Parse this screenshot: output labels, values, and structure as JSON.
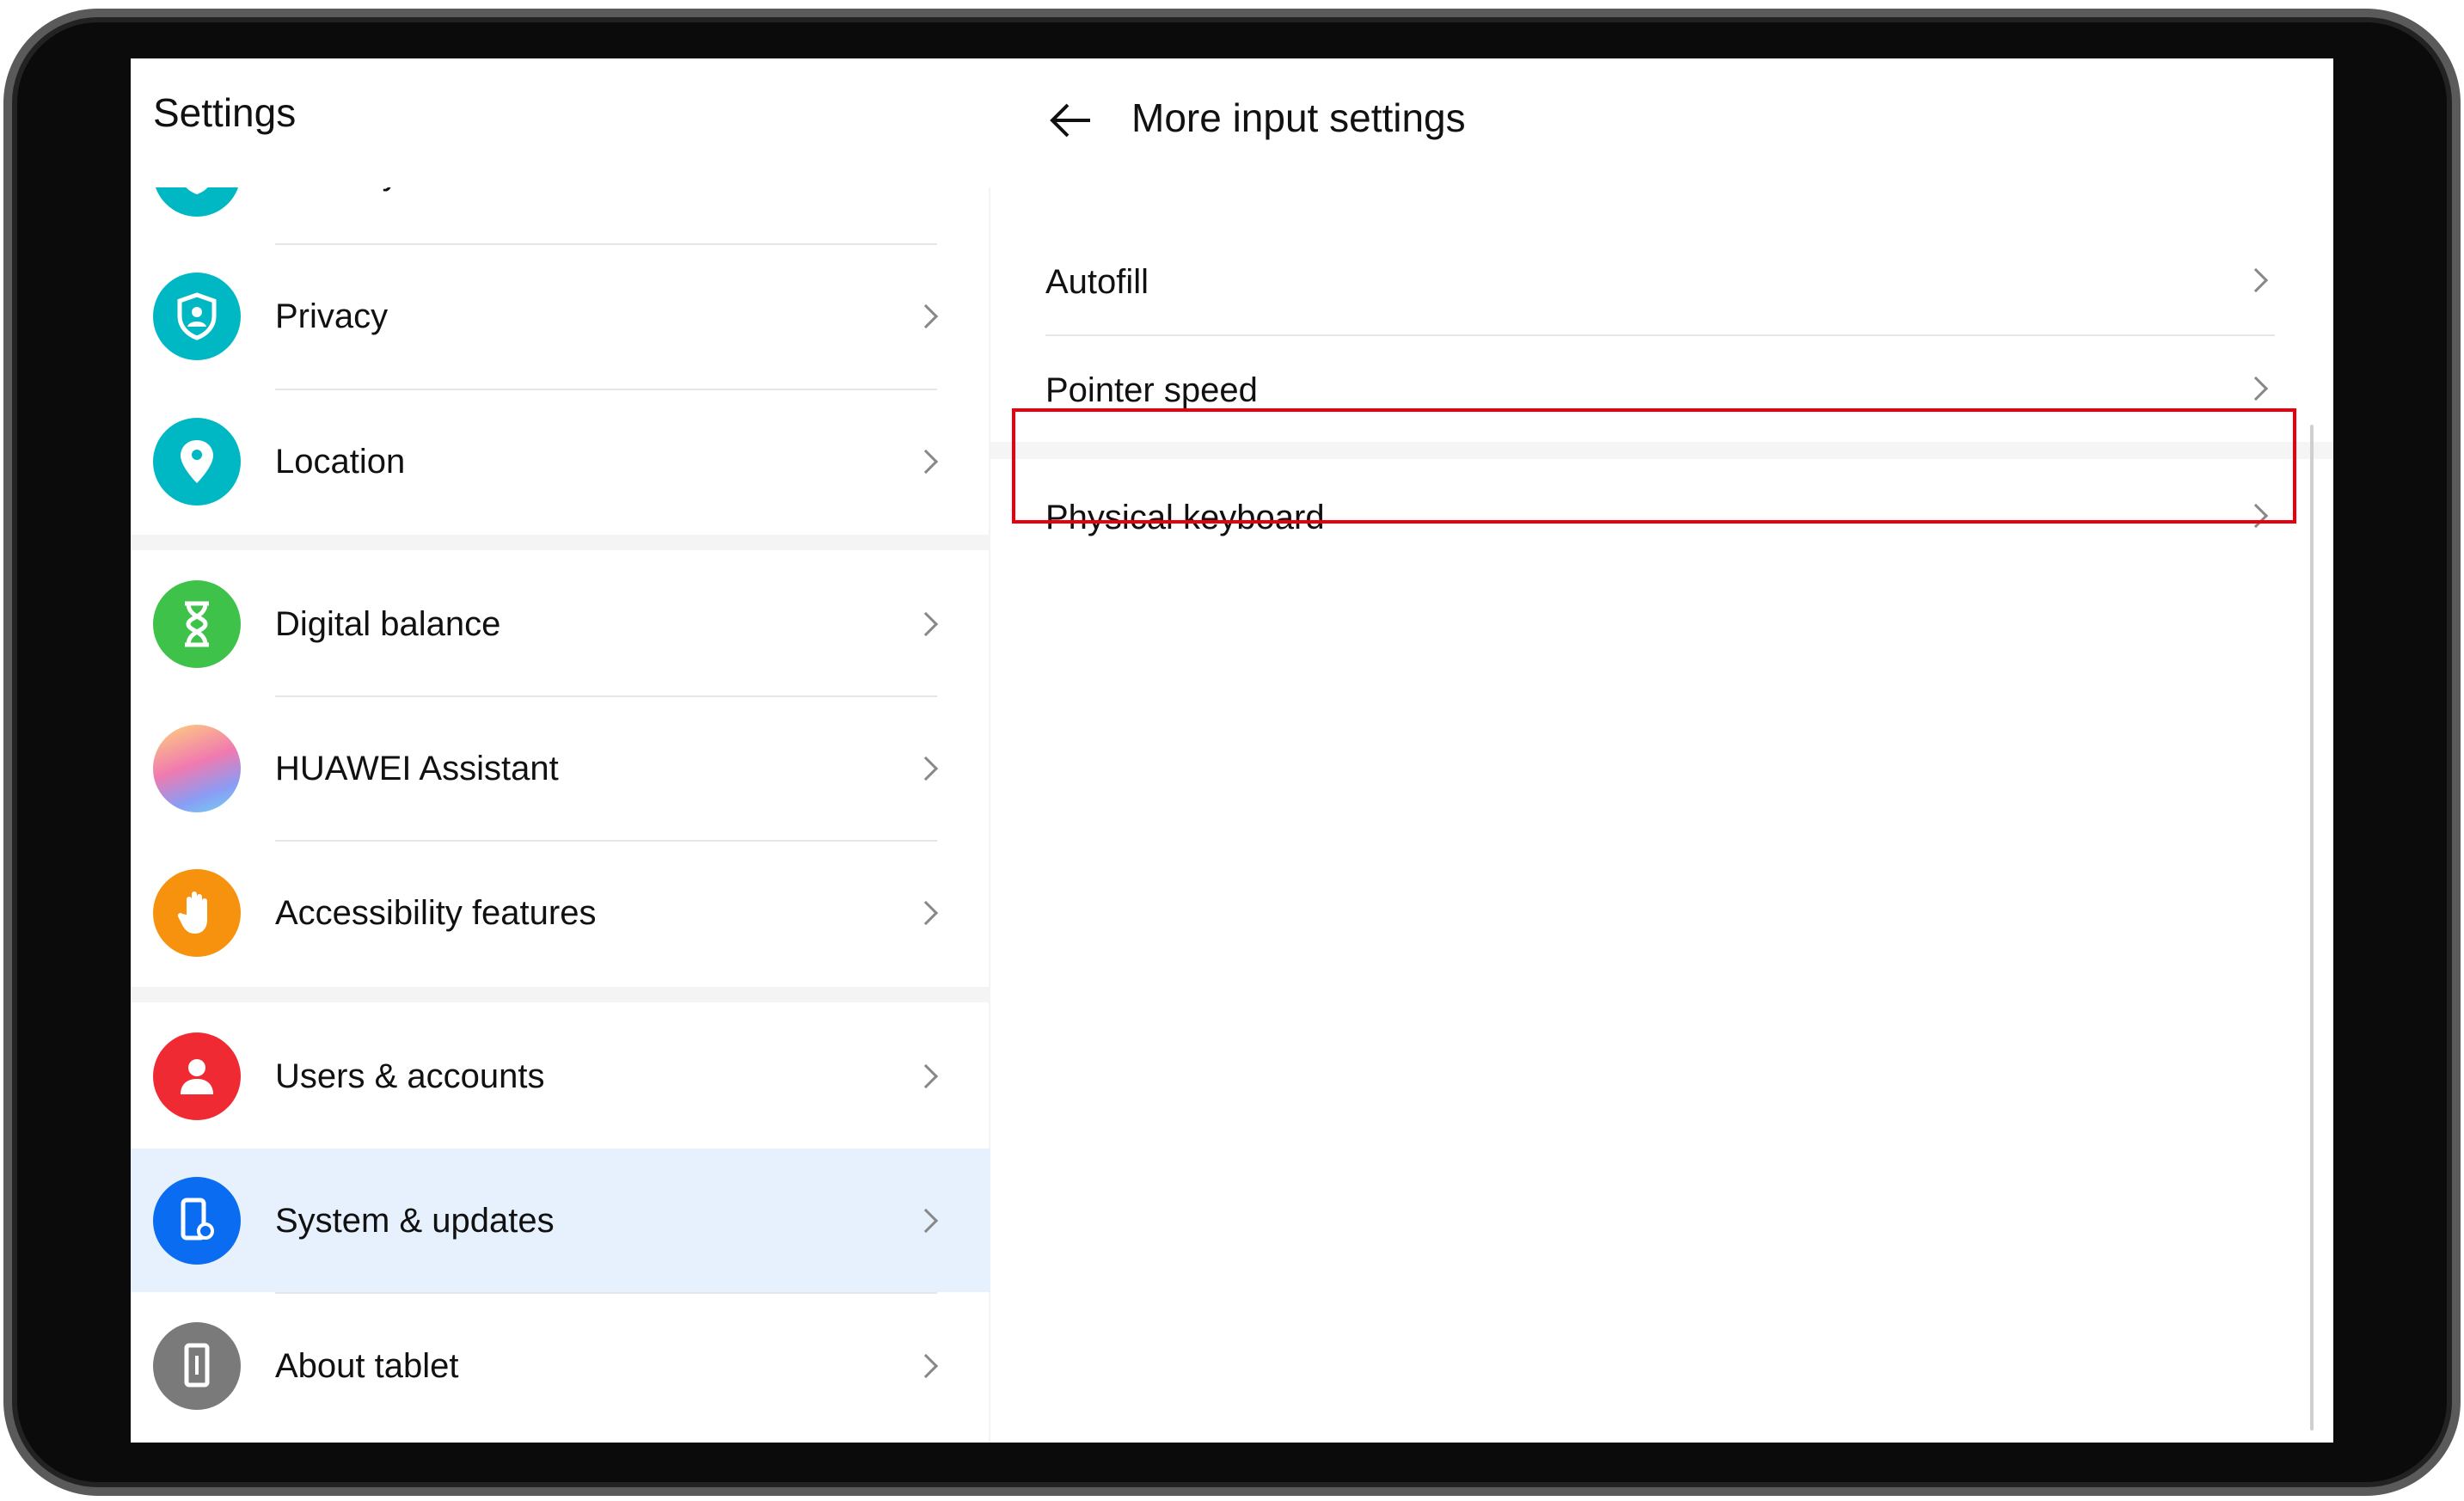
{
  "left": {
    "title": "Settings",
    "items": [
      {
        "label": "Security",
        "icon": "shield-check-icon",
        "color": "#00b8c4"
      },
      {
        "label": "Privacy",
        "icon": "privacy-shield-icon",
        "color": "#00b8c4"
      },
      {
        "label": "Location",
        "icon": "location-pin-icon",
        "color": "#00b8c4"
      },
      {
        "label": "Digital balance",
        "icon": "hourglass-icon",
        "color": "#3ec24a"
      },
      {
        "label": "HUAWEI Assistant",
        "icon": "assistant-icon",
        "color": "#c08ad8"
      },
      {
        "label": "Accessibility features",
        "icon": "hand-icon",
        "color": "#f7920f"
      },
      {
        "label": "Users & accounts",
        "icon": "user-icon",
        "color": "#ef2a32"
      },
      {
        "label": "System & updates",
        "icon": "system-icon",
        "color": "#0a6cf0",
        "selected": true
      },
      {
        "label": "About tablet",
        "icon": "tablet-icon",
        "color": "#7a7a7a"
      }
    ]
  },
  "right": {
    "title": "More input settings",
    "back": "back-arrow-icon",
    "items": [
      {
        "label": "Autofill"
      },
      {
        "label": "Pointer speed"
      },
      {
        "label": "Physical keyboard",
        "highlighted": true
      }
    ]
  },
  "colors": {
    "highlight_box": "#e8000f",
    "selected_row": "#e6f1fd"
  }
}
